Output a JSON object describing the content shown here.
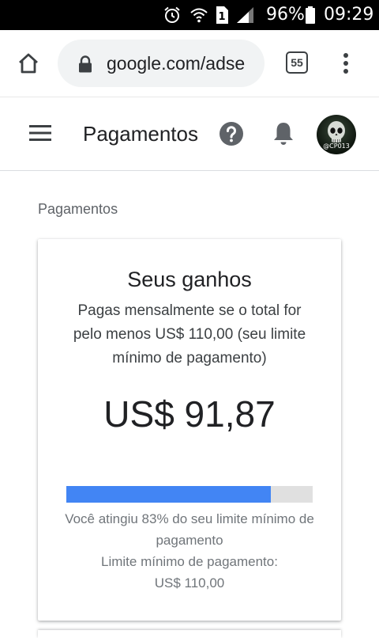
{
  "status_bar": {
    "battery": "96%",
    "time": "09:29",
    "sim_label": "1"
  },
  "browser": {
    "url": "google.com/adse",
    "tab_count": "55"
  },
  "header": {
    "title": "Pagamentos",
    "avatar_label": "@CP013"
  },
  "breadcrumb": "Pagamentos",
  "earnings_card": {
    "title": "Seus ganhos",
    "description": "Pagas mensalmente se o total for pelo menos US$ 110,00 (seu limite mínimo de pagamento)",
    "amount": "US$ 91,87",
    "progress_fraction": 0.83,
    "progress_text": "Você atingiu 83% do seu limite mínimo de pagamento",
    "threshold_label": "Limite mínimo de pagamento:",
    "threshold_value": "US$ 110,00"
  },
  "colors": {
    "progress_fill": "#4285f4",
    "progress_track": "#e0e0e0",
    "status_bar_bg": "#000000"
  }
}
